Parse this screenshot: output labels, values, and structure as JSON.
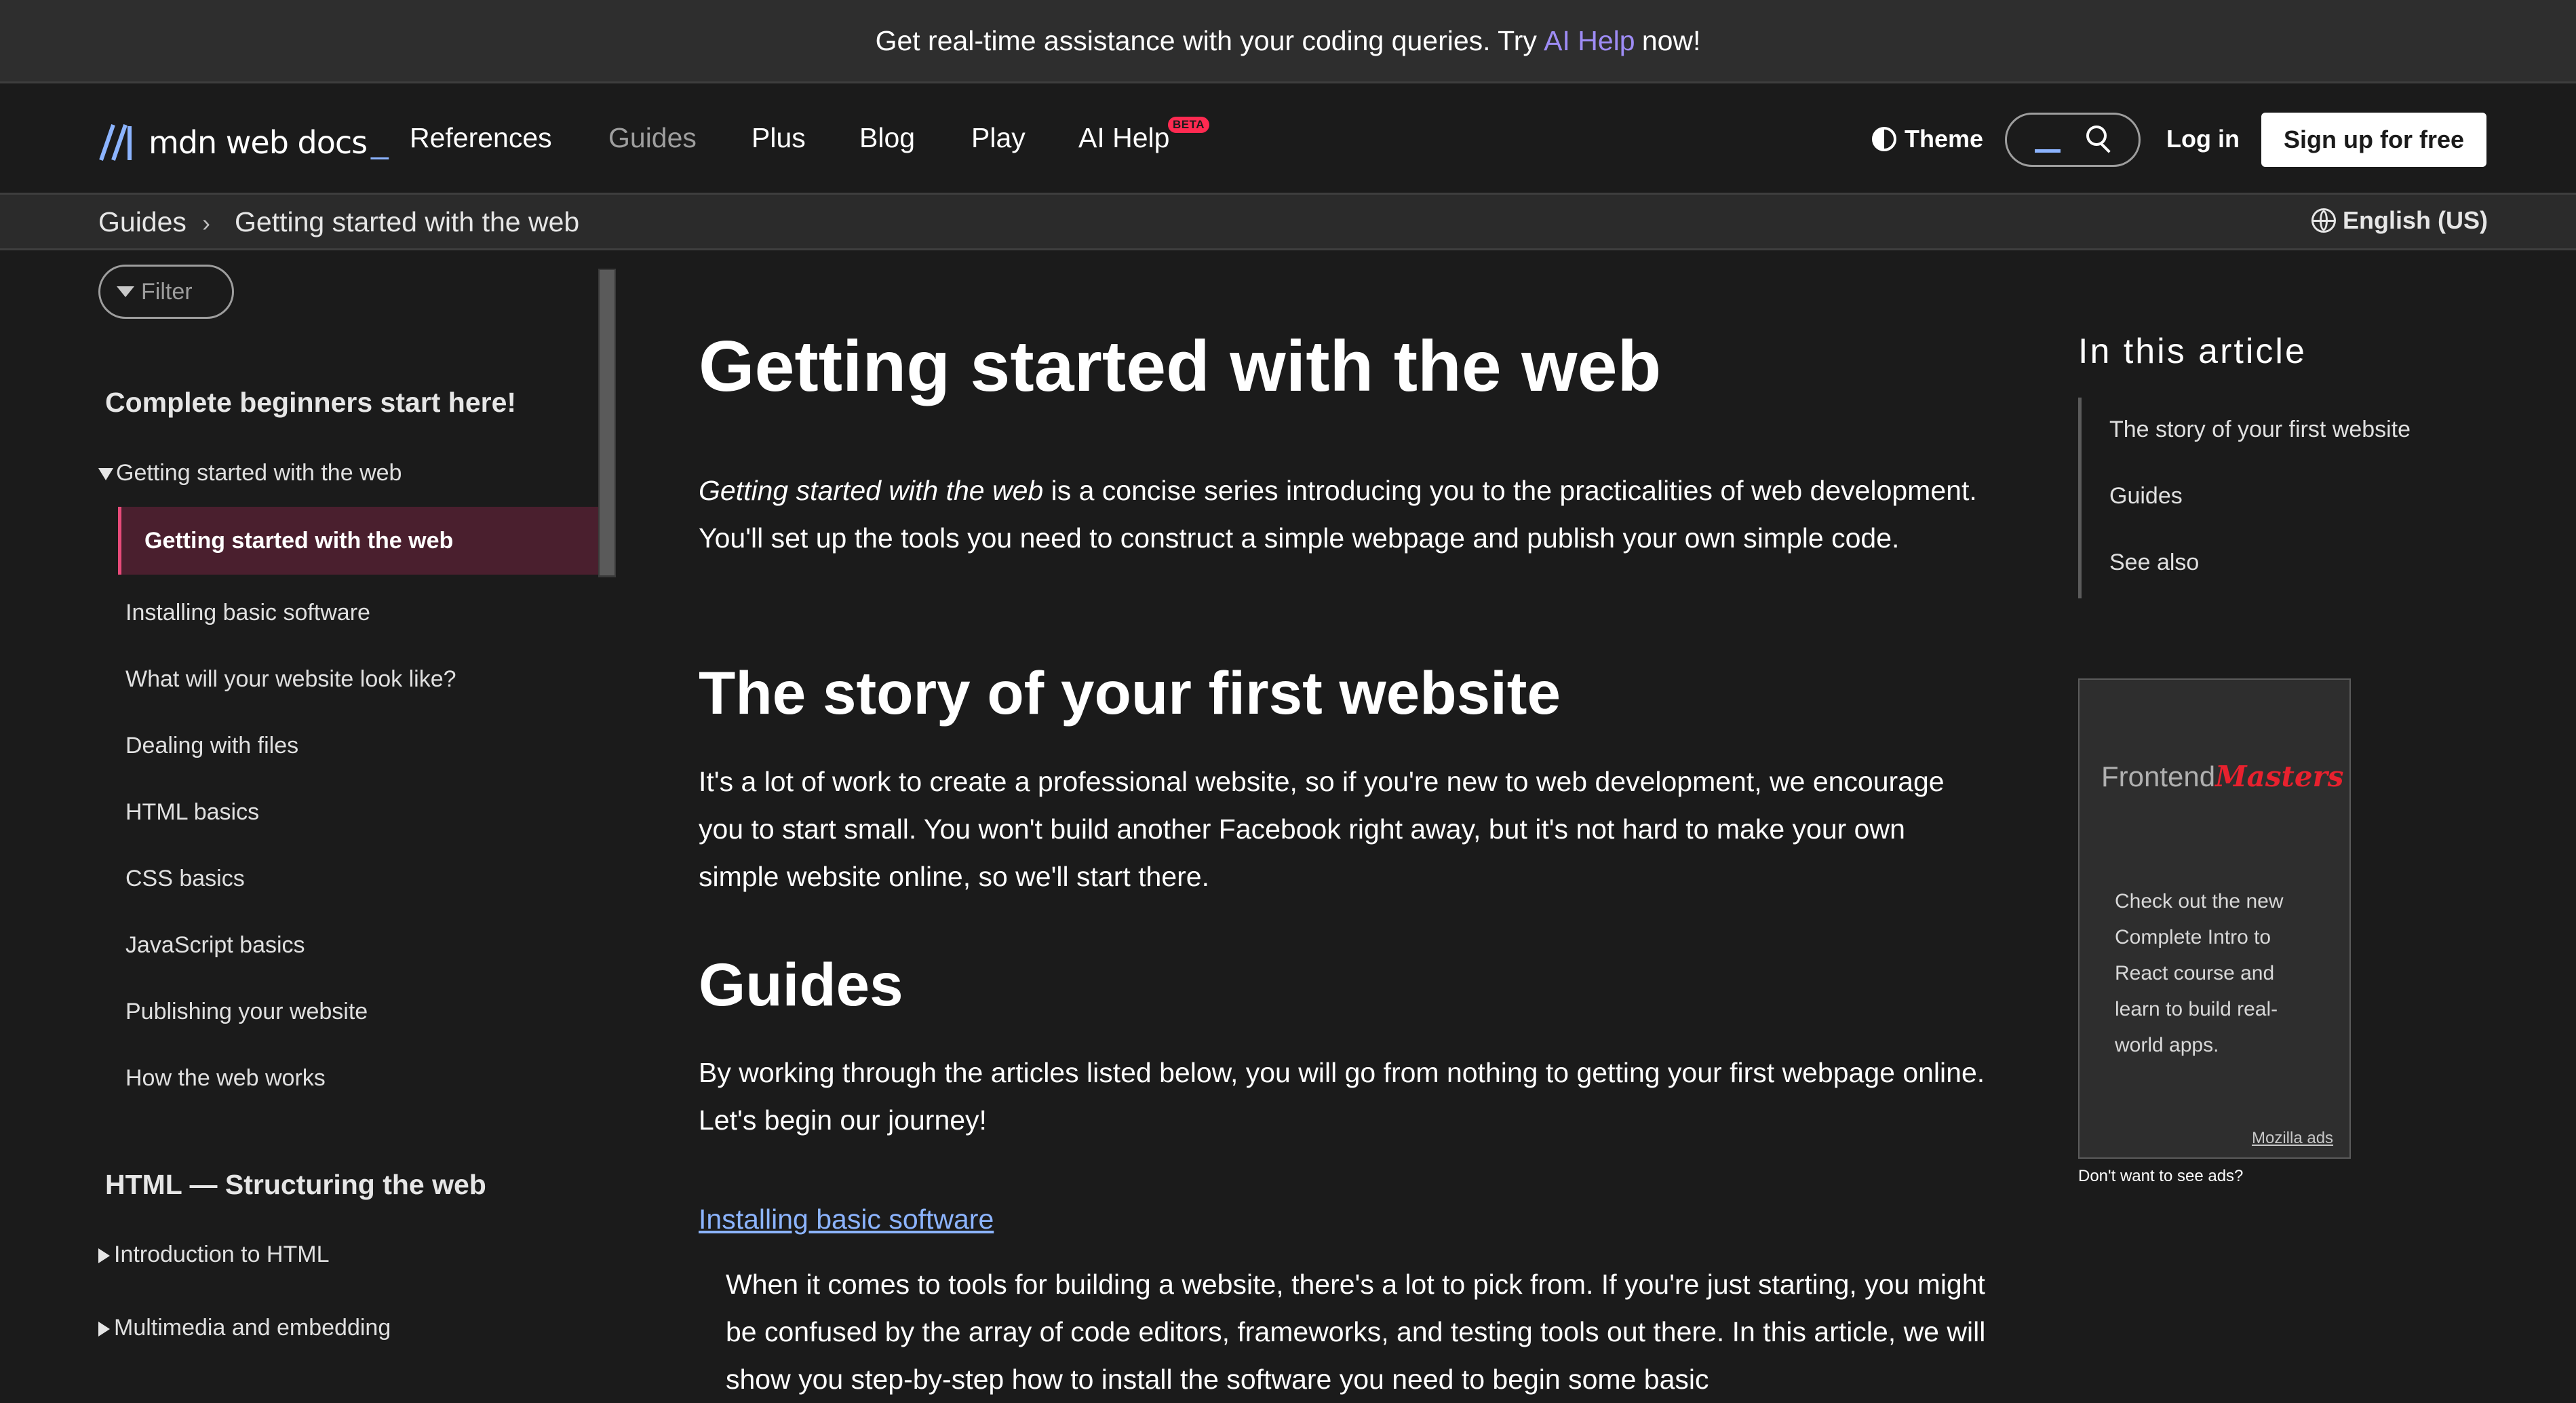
{
  "banner": {
    "prefix": "Get real-time assistance with your coding queries. Try",
    "link": "AI Help",
    "suffix": "now!"
  },
  "header": {
    "logo": "mdn web docs",
    "nav": [
      "References",
      "Guides",
      "Plus",
      "Blog",
      "Play",
      "AI Help"
    ],
    "beta": "BETA",
    "theme": "Theme",
    "login": "Log in",
    "signup": "Sign up for free"
  },
  "breadcrumb": {
    "items": [
      "Guides",
      "Getting started with the web"
    ],
    "sep": "›"
  },
  "language": "English (US)",
  "sidebar": {
    "filter": "Filter",
    "section1": "Complete beginners start here!",
    "group": "Getting started with the web",
    "active": "Getting started with the web",
    "items": [
      "Installing basic software",
      "What will your website look like?",
      "Dealing with files",
      "HTML basics",
      "CSS basics",
      "JavaScript basics",
      "Publishing your website",
      "How the web works"
    ],
    "section2": "HTML — Structuring the web",
    "sub": [
      "Introduction to HTML",
      "Multimedia and embedding"
    ]
  },
  "main": {
    "title": "Getting started with the web",
    "intro_em": "Getting started with the web",
    "intro_rest": " is a concise series introducing you to the practicalities of web development. You'll set up the tools you need to construct a simple webpage and publish your own simple code.",
    "h2_story": "The story of your first website",
    "story": "It's a lot of work to create a professional website, so if you're new to web development, we encourage you to start small. You won't build another Facebook right away, but it's not hard to make your own simple website online, so we'll start there.",
    "h2_guides": "Guides",
    "guides": "By working through the articles listed below, you will go from nothing to getting your first webpage online. Let's begin our journey!",
    "link1": "Installing basic software",
    "link1_desc": "When it comes to tools for building a website, there's a lot to pick from. If you're just starting, you might be confused by the array of code editors, frameworks, and testing tools out there. In this article, we will show you step-by-step how to install the software you need to begin some basic"
  },
  "toc": {
    "title": "In this article",
    "items": [
      "The story of your first website",
      "Guides",
      "See also"
    ]
  },
  "ad": {
    "logo_a": "Frontend",
    "logo_b": "Masters",
    "text": "Check out the new Complete Intro to React course and learn to build real-world apps.",
    "by": "Mozilla ads",
    "no": "Don't want to see ads?"
  },
  "colors": {
    "accent": "#8cb4ff",
    "banner_link": "#9e8cf5",
    "active_bg": "#4a1f2e",
    "active_border": "#e84b7a"
  }
}
